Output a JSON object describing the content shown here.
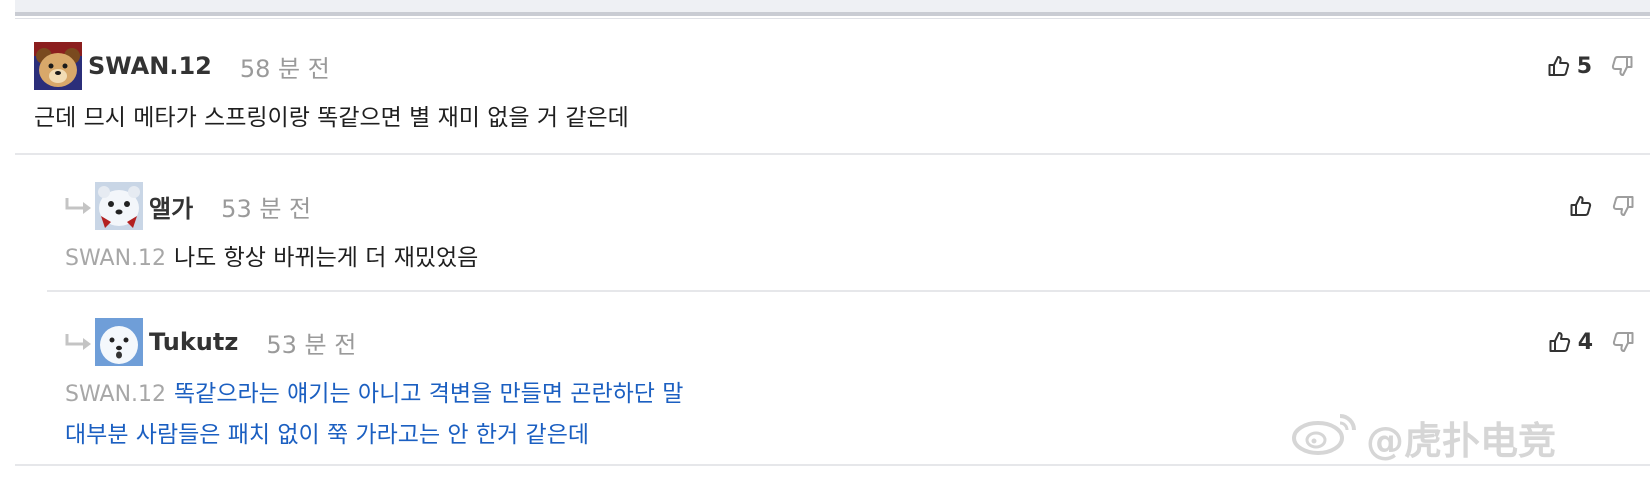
{
  "comments": [
    {
      "user": "SWAN.12",
      "time": "58 분 전",
      "text": "근데 므시 메타가 스프링이랑 똑같으면 별 재미 없을 거 같은데",
      "likes": "5",
      "avatar_icon": "bear-avatar-icon"
    },
    {
      "user": "앨가",
      "time": "53 분 전",
      "mention": "SWAN.12",
      "text": "나도 항상 바뀌는게 더 재밌었음",
      "likes": "",
      "avatar_icon": "polar-bear-avatar-icon"
    },
    {
      "user": "Tukutz",
      "time": "53 분 전",
      "mention": "SWAN.12",
      "text_line1": "똑같으라는 얘기는 아니고 격변을 만들면 곤란하단 말",
      "text_line2": "대부분 사람들은 패치 없이 쭉 가라고는 안 한거 같은데",
      "likes": "4",
      "avatar_icon": "white-dog-avatar-icon"
    }
  ],
  "watermark": "@虎扑电竞",
  "colors": {
    "reply_text_blue": "#1b5fc1",
    "muted": "#9a9a9a",
    "divider": "#e6e7ea"
  }
}
